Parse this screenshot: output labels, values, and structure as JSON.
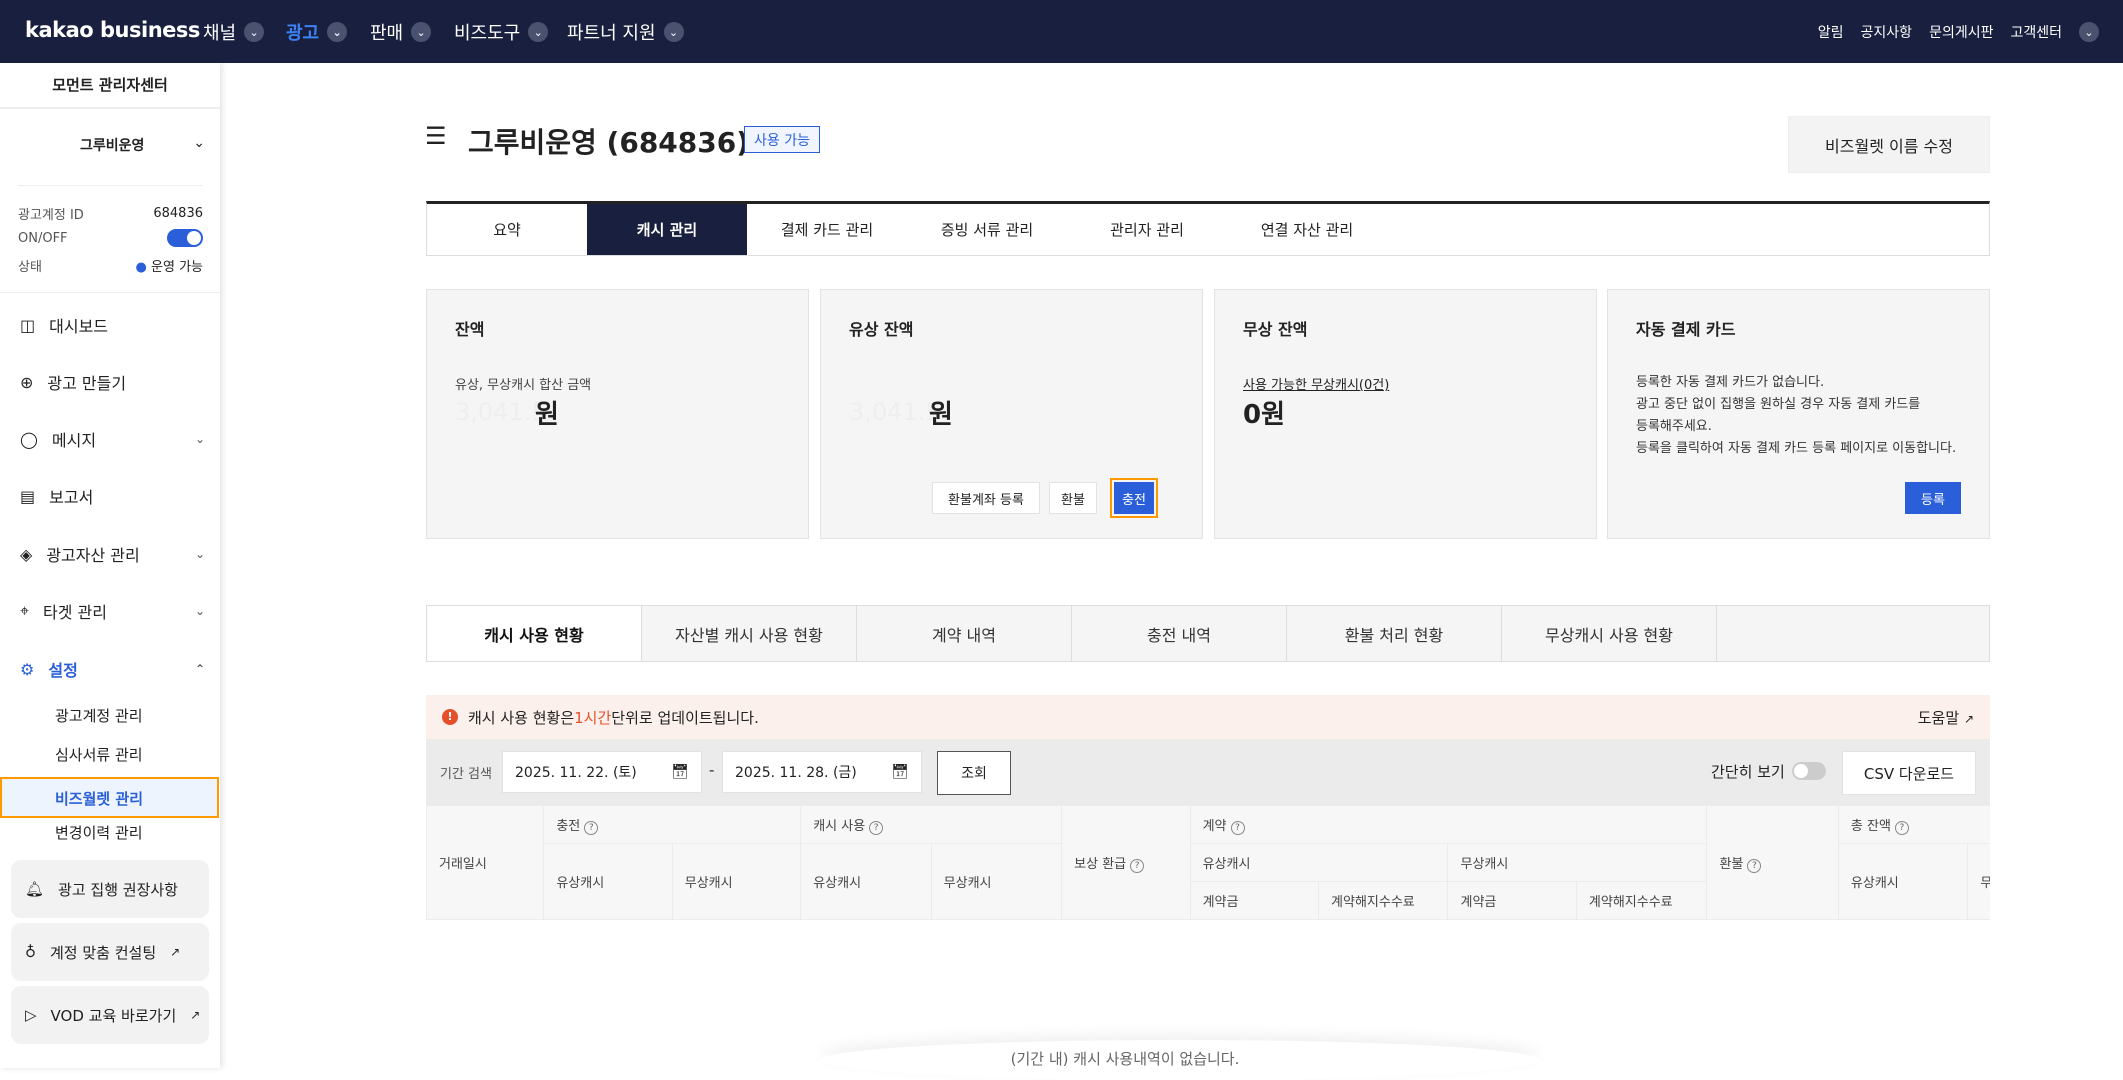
{
  "topbar": {
    "logo": "kakao business",
    "nav": [
      "채널",
      "광고",
      "판매",
      "비즈도구",
      "파트너 지원"
    ],
    "util": [
      "알림",
      "공지사항",
      "문의게시판",
      "고객센터"
    ]
  },
  "sidebar": {
    "title": "모먼트 관리자센터",
    "account": "그루비운영",
    "id_label": "광고계정 ID",
    "id_value": "684836",
    "onoff_label": "ON/OFF",
    "status_label": "상태",
    "status_value": "운영 가능",
    "menu": [
      "대시보드",
      "광고 만들기",
      "메시지",
      "보고서",
      "광고자산 관리",
      "타겟 관리",
      "설정"
    ],
    "submenu": [
      "광고계정 관리",
      "심사서류 관리",
      "비즈월렛 관리",
      "변경이력 관리"
    ],
    "cards": [
      "광고 집행 권장사항",
      "계정 맞춤 컨설팅",
      "VOD 교육 바로가기"
    ]
  },
  "page": {
    "title": "그루비운영 (684836)",
    "badge": "사용 가능",
    "rename_button": "비즈월렛 이름 수정",
    "tabs": [
      "요약",
      "캐시 관리",
      "결제 카드 관리",
      "증빙 서류 관리",
      "관리자 관리",
      "연결 자산 관리"
    ]
  },
  "cards": {
    "balance": {
      "title": "잔액",
      "desc": "유상, 무상캐시 합산 금액",
      "amount": "3,041.5",
      "unit": "원"
    },
    "paid": {
      "title": "유상 잔액",
      "amount": "3,041.5",
      "unit": "원",
      "buttons": [
        "환불계좌 등록",
        "환불",
        "충전"
      ]
    },
    "free": {
      "title": "무상 잔액",
      "link": "사용 가능한 무상캐시(0건)",
      "amount": "0원"
    },
    "autocard": {
      "title": "자동 결제 카드",
      "lines": [
        "등록한 자동 결제 카드가 없습니다.",
        "광고 중단 없이 집행을 원하실 경우 자동 결제 카드를",
        "등록해주세요.",
        "등록을 클릭하여 자동 결제 카드 등록 페이지로 이동합니다."
      ],
      "button": "등록"
    }
  },
  "subtabs": [
    "캐시 사용 현황",
    "자산별 캐시 사용 현황",
    "계약 내역",
    "충전 내역",
    "환불 처리 현황",
    "무상캐시 사용 현황"
  ],
  "notice": {
    "pre": "캐시 사용 현황은 ",
    "hl": "1시간",
    "post": " 단위로 업데이트됩니다.",
    "help": "도움말"
  },
  "filter": {
    "label": "기간 검색",
    "start": "2025. 11. 22. (토)",
    "end": "2025. 11. 28. (금)",
    "sep": "-",
    "search": "조회",
    "simple": "간단히 보기",
    "csv": "CSV 다운로드"
  },
  "table": {
    "date": "거래일시",
    "charge": "충전",
    "use": "캐시 사용",
    "reward": "보상 환급",
    "contract": "계약",
    "refund": "환불",
    "total": "총 잔액",
    "paid": "유상캐시",
    "free": "무상캐시",
    "fee": "계약금",
    "cancel": "계약해지수수료",
    "free_cut": "무상캐"
  },
  "empty": "(기간 내) 캐시 사용내역이 없습니다.",
  "colors": {
    "navy": "#19203f",
    "blue": "#2a5fd9",
    "highlight": "#ff9900"
  }
}
